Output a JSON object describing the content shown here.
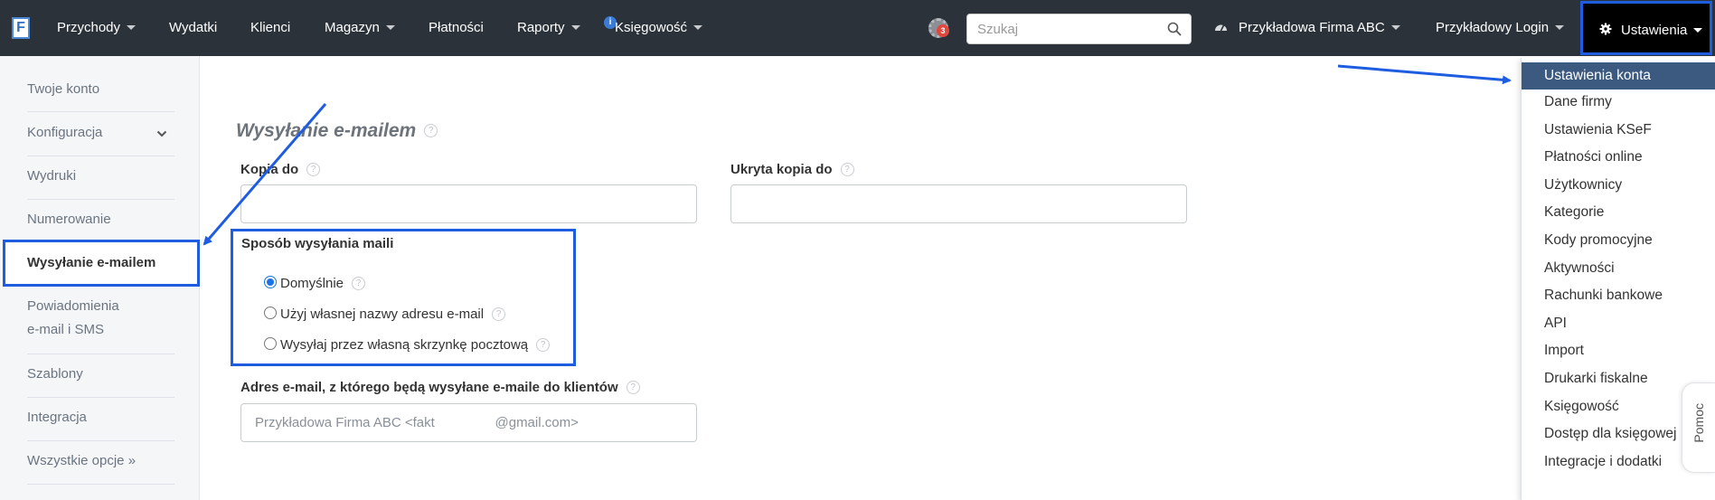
{
  "topnav": {
    "logo": "F",
    "items": [
      "Przychody",
      "Wydatki",
      "Klienci",
      "Magazyn",
      "Płatności",
      "Raporty",
      "Księgowość"
    ],
    "info_badge": "i",
    "alert_count": "3",
    "search": {
      "placeholder": "Szukaj"
    },
    "company": "Przykładowa Firma ABC",
    "login": "Przykładowy Login",
    "settings": "Ustawienia"
  },
  "sidebar": {
    "items": [
      "Twoje konto",
      "Konfiguracja",
      "Wydruki",
      "Numerowanie",
      "Wysyłanie e-mailem",
      "Powiadomienia e-mail i SMS",
      "Szablony",
      "Integracja",
      "Wszystkie opcje »"
    ],
    "notif_line1": "Powiadomienia",
    "notif_line2": "e-mail i SMS"
  },
  "main": {
    "title": "Wysyłanie e-mailem",
    "cc_label": "Kopia do",
    "bcc_label": "Ukryta kopia do",
    "cc_value": "",
    "bcc_value": "",
    "method_label": "Sposób wysyłania maili",
    "method_options": [
      "Domyślnie",
      "Użyj własnej nazwy adresu e-mail",
      "Wysyłaj przez własną skrzynkę pocztową"
    ],
    "method_selected": "Domyślnie",
    "sender_label": "Adres e-mail, z którego będą wysyłane e-maile do klientów",
    "sender_placeholder": "Przykładowa Firma ABC <fakt                @gmail.com>",
    "help_glyph": "?"
  },
  "settings_menu": {
    "items": [
      "Ustawienia konta",
      "Dane firmy",
      "Ustawienia KSeF",
      "Płatności online",
      "Użytkownicy",
      "Kategorie",
      "Kody promocyjne",
      "Aktywności",
      "Rachunki bankowe",
      "API",
      "Import",
      "Drukarki fiskalne",
      "Księgowość",
      "Dostęp dla księgowej",
      "Integracje i dodatki"
    ],
    "active": "Ustawienia konta"
  },
  "help_tab": "Pomoc",
  "colors": {
    "nav_bg": "#2b323a",
    "highlight": "#1e5ce0",
    "menu_active": "#3c5a80"
  }
}
